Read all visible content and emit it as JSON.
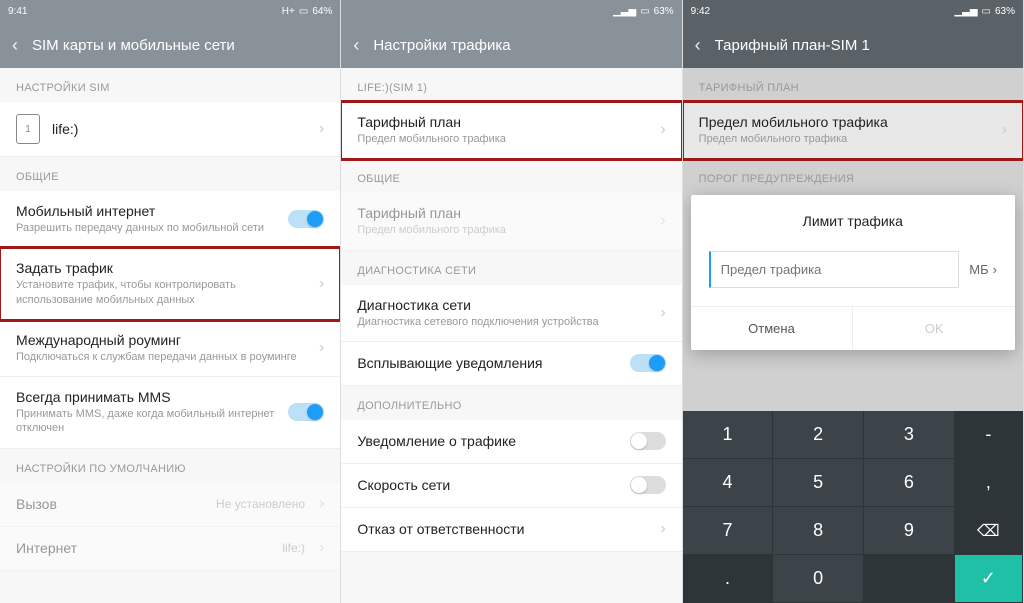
{
  "screen1": {
    "status": {
      "time": "9:41",
      "net": "H+",
      "battery": "64%"
    },
    "title": "SIM карты и мобильные сети",
    "section_sim": "НАСТРОЙКИ SIM",
    "sim_label": "life:)",
    "section_general": "ОБЩИЕ",
    "mobile_data": {
      "title": "Мобильный интернет",
      "sub": "Разрешить передачу данных по мобильной сети"
    },
    "set_traffic": {
      "title": "Задать трафик",
      "sub": "Установите трафик, чтобы контролировать использование мобильных данных"
    },
    "roaming": {
      "title": "Международный роуминг",
      "sub": "Подключаться к службам передачи данных в роуминге"
    },
    "mms": {
      "title": "Всегда принимать MMS",
      "sub": "Принимать MMS, даже когда мобильный интернет отключен"
    },
    "section_defaults": "НАСТРОЙКИ ПО УМОЛЧАНИЮ",
    "call": {
      "title": "Вызов",
      "value": "Не установлено"
    },
    "internet": {
      "title": "Интернет",
      "value": "life:)"
    }
  },
  "screen2": {
    "status": {
      "time": "",
      "battery": "63%"
    },
    "title": "Настройки трафика",
    "section_life": "LIFE:)(SIM 1)",
    "tariff1": {
      "title": "Тарифный план",
      "sub": "Предел мобильного трафика"
    },
    "section_general": "ОБЩИЕ",
    "tariff2": {
      "title": "Тарифный план",
      "sub": "Предел мобильного трафика"
    },
    "section_diag": "ДИАГНОСТИКА СЕТИ",
    "diag": {
      "title": "Диагностика сети",
      "sub": "Диагностика сетевого подключения устройства"
    },
    "popup": "Всплывающие уведомления",
    "section_extra": "ДОПОЛНИТЕЛЬНО",
    "notify": "Уведомление о трафике",
    "speed": "Скорость сети",
    "disclaimer": "Отказ от ответственности"
  },
  "screen3": {
    "status": {
      "time": "9:42",
      "battery": "63%"
    },
    "title": "Тарифный план-SIM 1",
    "section_plan": "ТАРИФНЫЙ ПЛАН",
    "limit": {
      "title": "Предел мобильного трафика",
      "sub": "Предел мобильного трафика"
    },
    "section_warn": "ПОРОГ ПРЕДУПРЕЖДЕНИЯ",
    "dialog": {
      "title": "Лимит трафика",
      "placeholder": "Предел трафика",
      "unit": "МБ",
      "cancel": "Отмена",
      "ok": "OK"
    },
    "keypad": {
      "r1": [
        "1",
        "2",
        "3",
        "-"
      ],
      "r2": [
        "4",
        "5",
        "6",
        ","
      ],
      "r3": [
        "7",
        "8",
        "9",
        "⌫"
      ],
      "r4": [
        ".",
        "0",
        " ",
        "✓"
      ]
    }
  }
}
